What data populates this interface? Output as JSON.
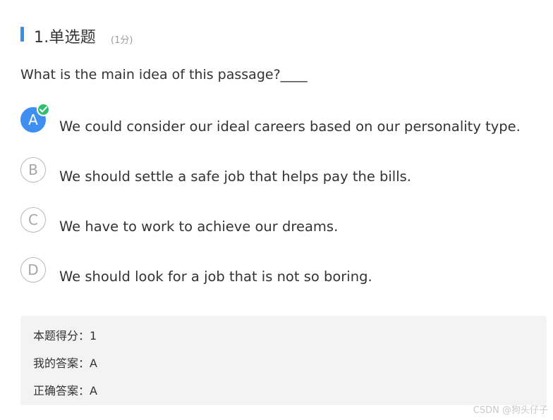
{
  "question": {
    "title": "1.单选题",
    "points": "(1分)",
    "stem": "What is the main idea of this passage?____",
    "options": [
      {
        "letter": "A",
        "text": "We could consider our ideal careers based on our personality type.",
        "selected": true
      },
      {
        "letter": "B",
        "text": "We should settle a safe job that helps pay the bills.",
        "selected": false
      },
      {
        "letter": "C",
        "text": "We have to work to achieve our dreams.",
        "selected": false
      },
      {
        "letter": "D",
        "text": "We should look for a job that is not so boring.",
        "selected": false
      }
    ]
  },
  "result": {
    "score_line": "本题得分：1",
    "my_answer_line": "我的答案：A",
    "correct_answer_line": "正确答案：A"
  },
  "watermark": "CSDN @狗头仔子",
  "colors": {
    "accent_blue": "#3f8ff3",
    "header_bar": "#3a8ee6",
    "check_green": "#2fbf71",
    "result_bg": "#f3f3f3"
  },
  "icons": {
    "selected_badge": "check-icon"
  }
}
